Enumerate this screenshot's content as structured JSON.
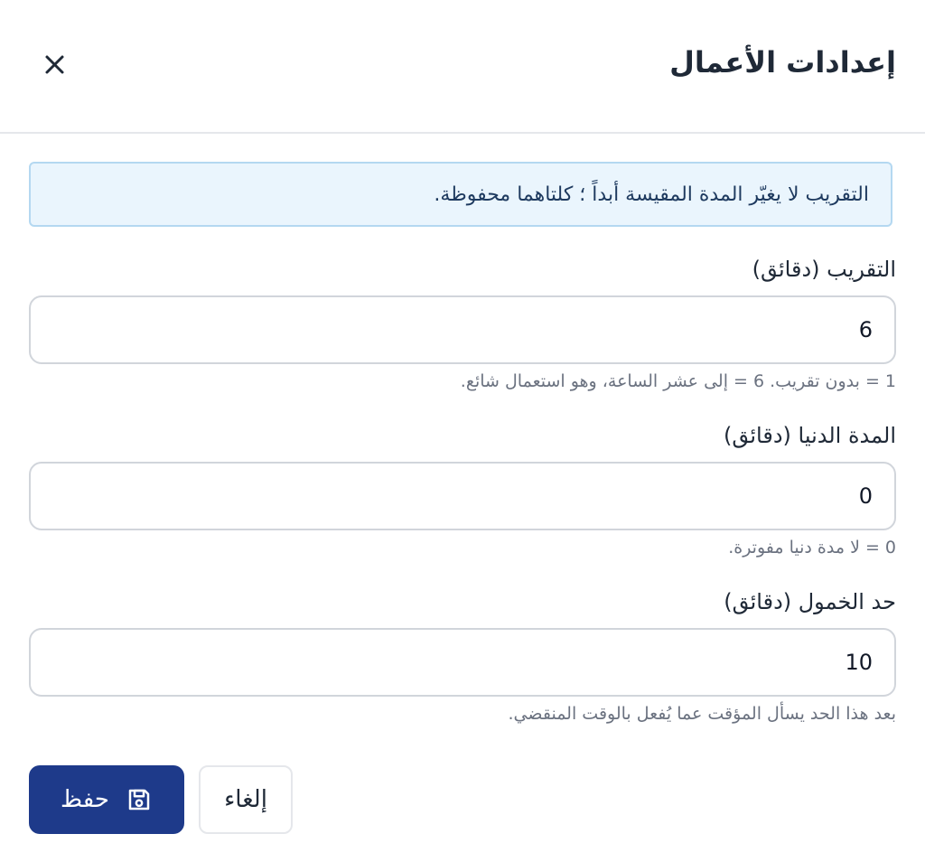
{
  "dialog": {
    "title": "إعدادات الأعمال",
    "close_icon": "close-icon"
  },
  "info": {
    "text": "التقريب لا يغيّر المدة المقيسة أبداً ؛ كلتاهما محفوظة."
  },
  "fields": {
    "rounding": {
      "label": "التقريب (دقائق)",
      "value": "6",
      "help": "1 = بدون تقريب. 6 = إلى عشر الساعة، وهو استعمال شائع."
    },
    "minimum": {
      "label": "المدة الدنيا (دقائق)",
      "value": "0",
      "help": "0 = لا مدة دنيا مفوترة."
    },
    "idle": {
      "label": "حد الخمول (دقائق)",
      "value": "10",
      "help": "بعد هذا الحد يسأل المؤقت عما يُفعل بالوقت المنقضي."
    }
  },
  "buttons": {
    "save_label": "حفظ",
    "save_icon": "save-icon",
    "cancel_label": "إلغاء"
  },
  "colors": {
    "primary": "#1e3a8a",
    "info_bg": "#eaf5fd",
    "info_border": "#b4d8f1"
  }
}
